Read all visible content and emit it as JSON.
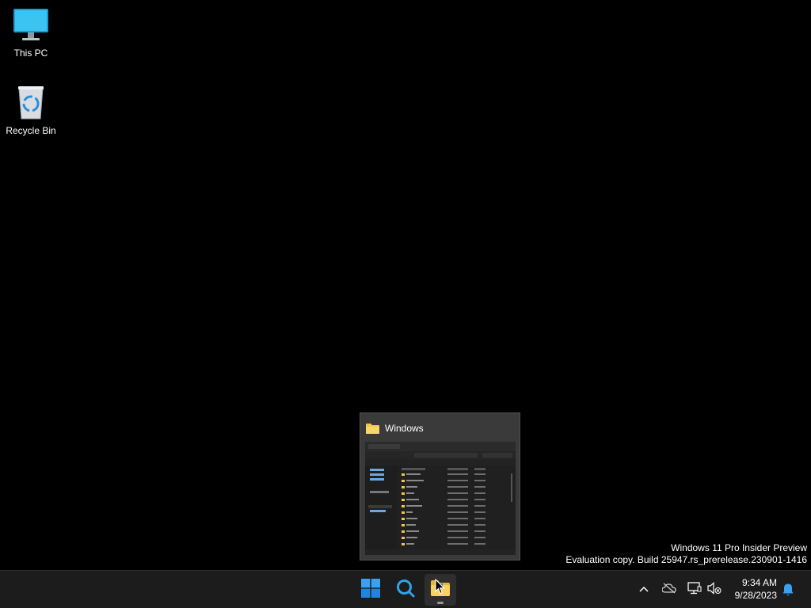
{
  "desktop": {
    "icons": [
      {
        "label": "This PC",
        "icon": "monitor-icon"
      },
      {
        "label": "Recycle Bin",
        "icon": "recycle-bin-icon"
      }
    ]
  },
  "watermark": {
    "line1": "Windows 11 Pro Insider Preview",
    "line2": "Evaluation copy. Build 25947.rs_prerelease.230901-1416"
  },
  "preview": {
    "title": "Windows",
    "icon": "folder-icon"
  },
  "taskbar": {
    "buttons": [
      {
        "name": "start",
        "icon": "windows-logo-icon"
      },
      {
        "name": "search",
        "icon": "search-icon"
      },
      {
        "name": "file-explorer",
        "icon": "folder-icon",
        "active": true
      }
    ],
    "tray": {
      "icons": [
        "chevron-up-icon",
        "cloud-off-icon",
        "network-icon",
        "volume-muted-icon",
        "bell-icon"
      ]
    },
    "clock": {
      "time": "9:34 AM",
      "date": "9/28/2023"
    }
  },
  "colors": {
    "desktop_bg": "#000000",
    "taskbar_bg": "#1c1c1c",
    "accent_blue": "#0078d4",
    "folder_yellow": "#f3c74a"
  }
}
